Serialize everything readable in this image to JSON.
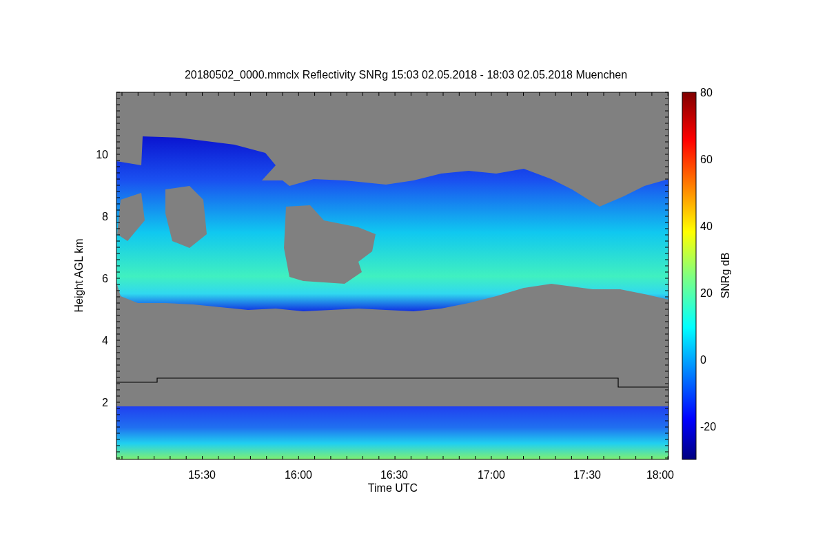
{
  "title": "20180502_0000.mmclx Reflectivity SNRg   15:03 02.05.2018 - 18:03 02.05.2018 Muenchen",
  "y_axis": {
    "label": "Height AGL km",
    "ticks": [
      "10",
      "8",
      "6",
      "4",
      "2"
    ]
  },
  "x_axis": {
    "label": "Time UTC",
    "ticks": [
      "15:30",
      "16:00",
      "16:30",
      "17:00",
      "17:30",
      "18:00"
    ]
  },
  "colorbar": {
    "label": "SNRg dB",
    "ticks": [
      "80",
      "60",
      "40",
      "20",
      "0",
      "-20"
    ]
  }
}
